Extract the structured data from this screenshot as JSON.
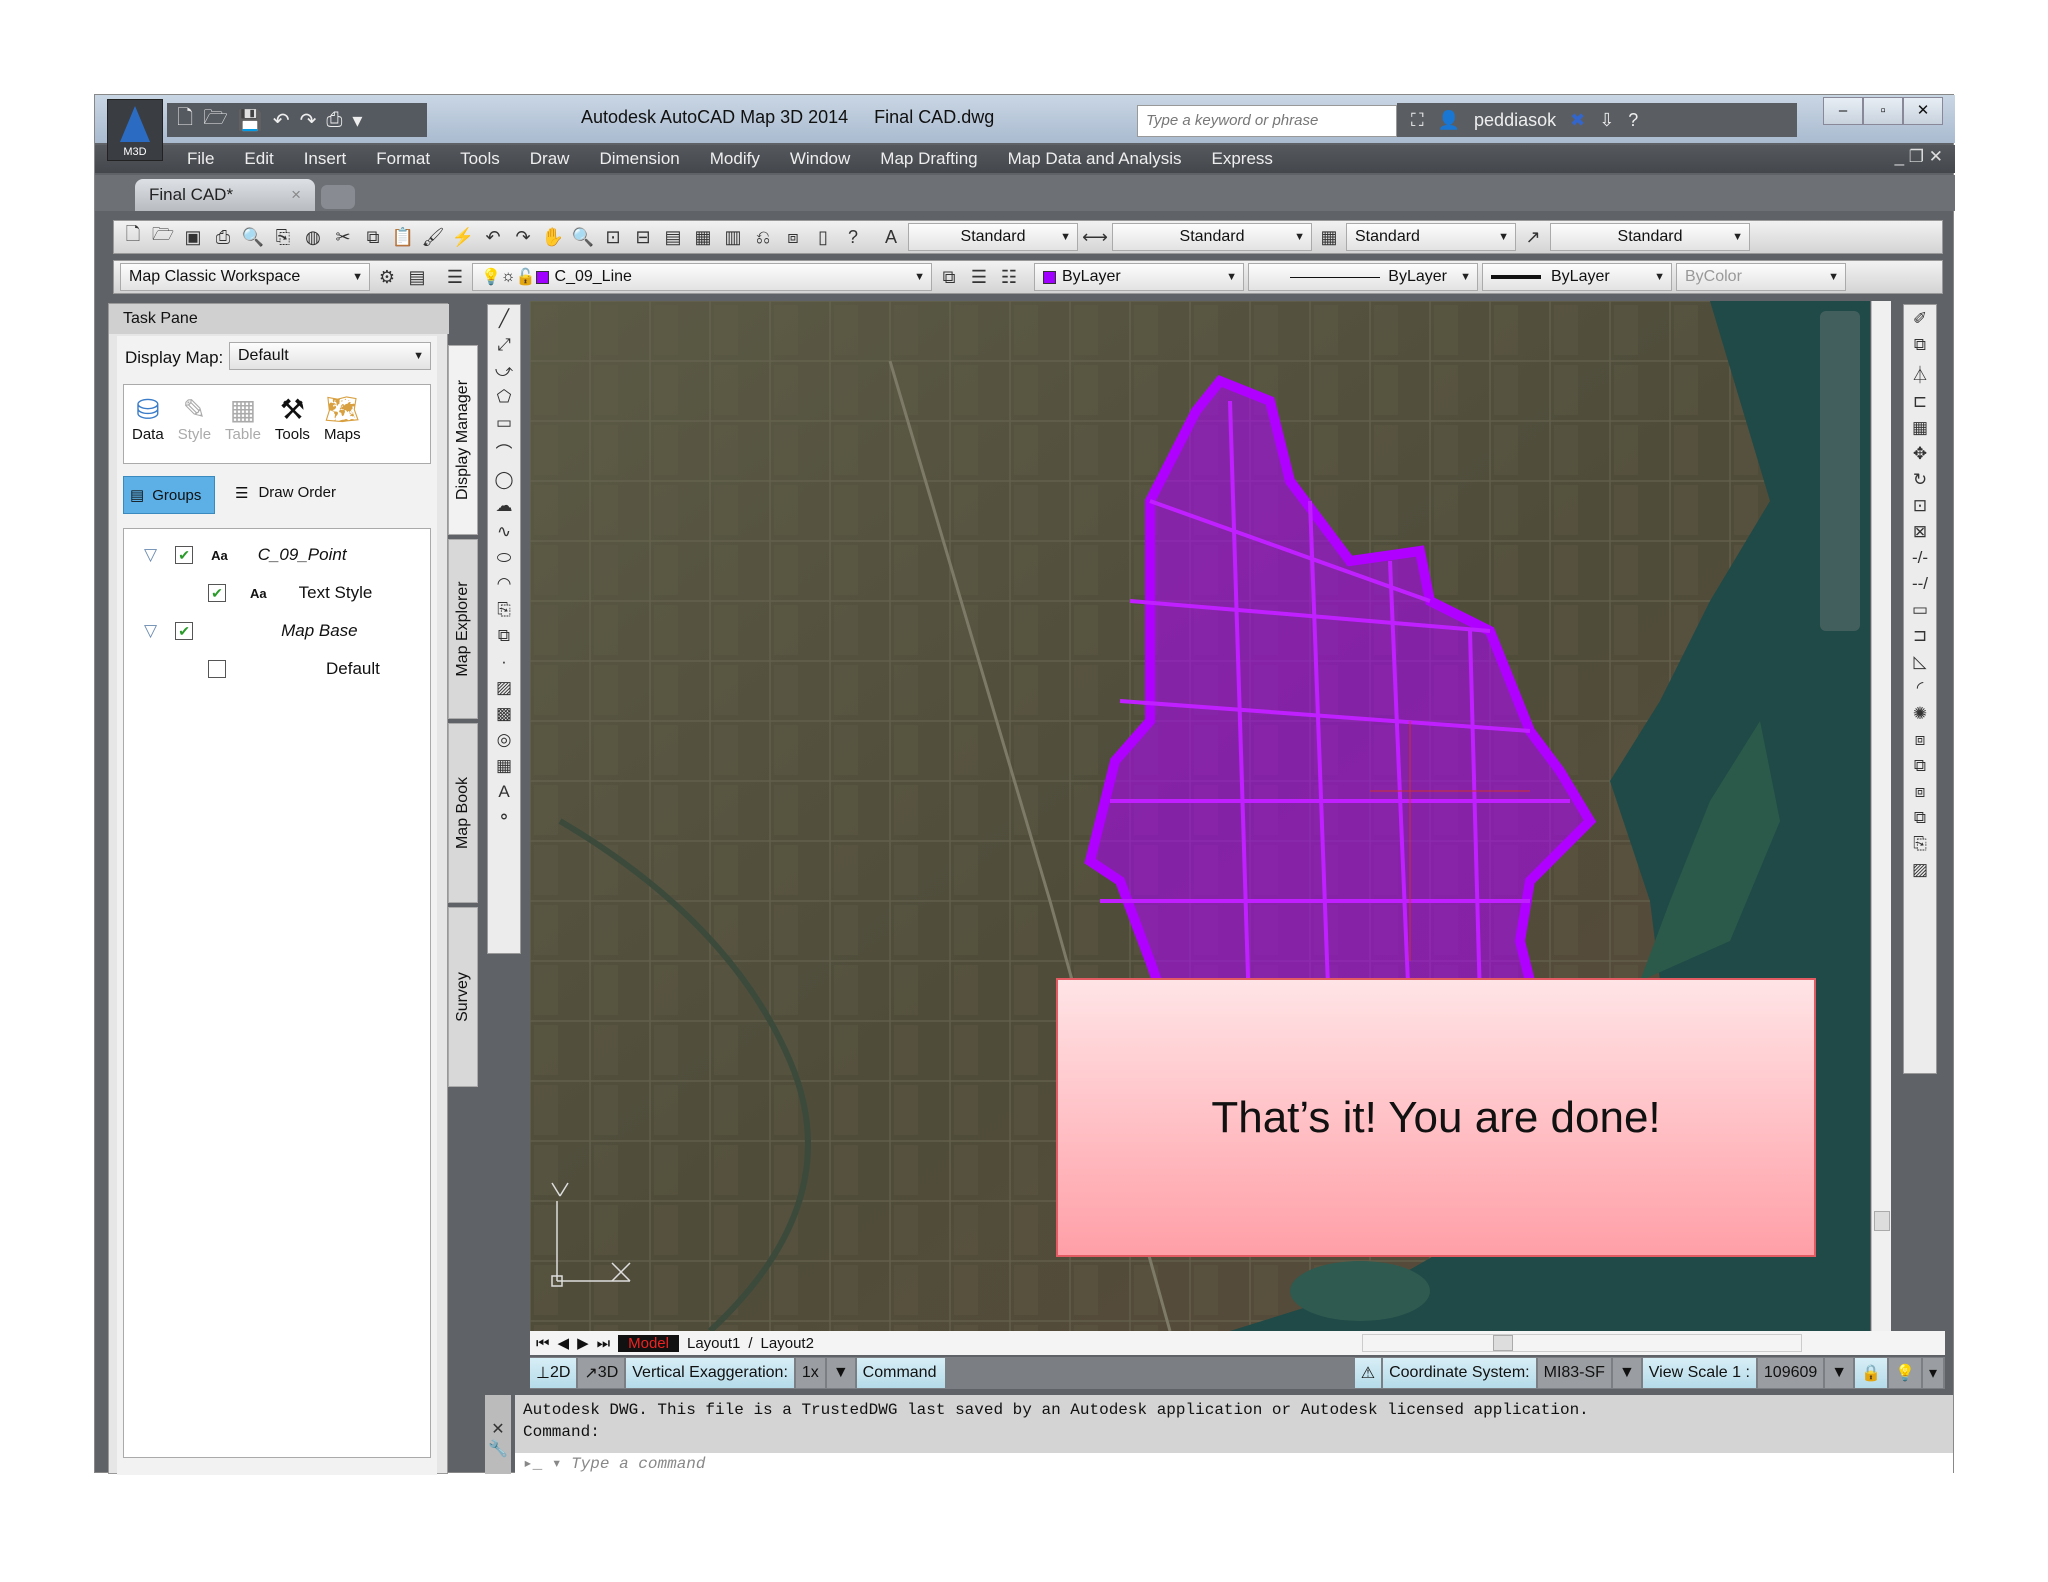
{
  "app": {
    "title": "Autodesk AutoCAD Map 3D 2014",
    "file": "Final CAD.dwg",
    "logo_text": "M3D"
  },
  "search": {
    "placeholder": "Type a keyword or phrase"
  },
  "user": {
    "name": "peddiasok"
  },
  "menu": [
    "File",
    "Edit",
    "Insert",
    "Format",
    "Tools",
    "Draw",
    "Dimension",
    "Modify",
    "Window",
    "Map Drafting",
    "Map Data and Analysis",
    "Express"
  ],
  "doc_tab": {
    "label": "Final CAD*",
    "close": "×"
  },
  "styles_toolbar": {
    "text_style": "Standard",
    "dim_style": "Standard",
    "table_style": "Standard",
    "mleader_style": "Standard"
  },
  "layers_toolbar": {
    "workspace": "Map Classic Workspace",
    "layer": "C_09_Line",
    "color": "ByLayer",
    "linetype": "ByLayer",
    "lineweight": "ByLayer",
    "plotstyle": "ByColor"
  },
  "task_pane": {
    "title": "Task Pane",
    "display_map_label": "Display Map:",
    "display_map_value": "Default",
    "tools": [
      "Data",
      "Style",
      "Table",
      "Tools",
      "Maps"
    ],
    "groups": "Groups",
    "draw_order": "Draw Order",
    "tree": [
      {
        "label": "C_09_Point",
        "checked": true,
        "level": 0
      },
      {
        "label": "Text Style",
        "checked": true,
        "level": 1
      },
      {
        "label": "Map Base",
        "checked": true,
        "level": 0
      },
      {
        "label": "Default",
        "checked": false,
        "level": 1
      }
    ],
    "side_tabs": [
      "Display Manager",
      "Map Explorer",
      "Map Book",
      "Survey"
    ]
  },
  "layout_tabs": [
    "Model",
    "Layout1",
    "Layout2"
  ],
  "status": {
    "d2": "2D",
    "d3": "3D",
    "vert_exag_label": "Vertical Exaggeration:",
    "vert_exag": "1x",
    "command": "Command",
    "coord_label": "Coordinate System:",
    "coord": "MI83-SF",
    "view_scale_label": "View Scale  1 :",
    "view_scale": "109609"
  },
  "command": {
    "history": [
      "Autodesk DWG.  This file is a TrustedDWG last saved by an Autodesk application or Autodesk licensed application.",
      "Command:"
    ],
    "placeholder": "Type a command"
  },
  "overlay": {
    "message": "That’s it! You are done!"
  },
  "colors": {
    "parcels": "#b000ff",
    "water": "#1f4a47"
  }
}
